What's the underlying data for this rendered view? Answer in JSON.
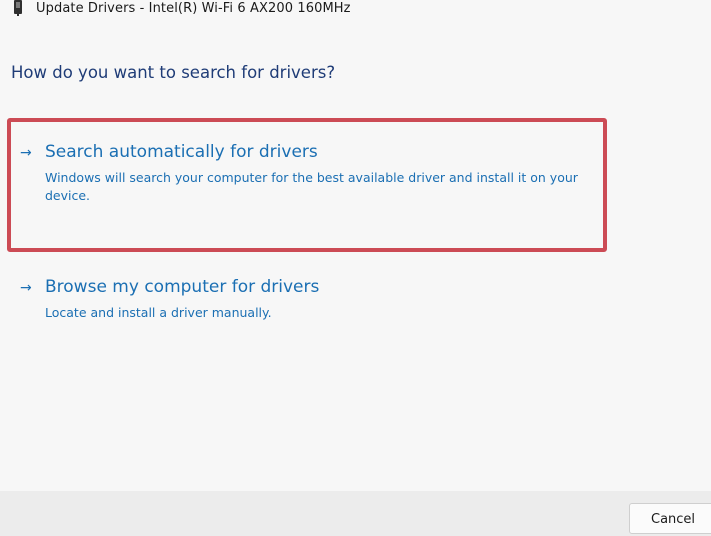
{
  "window": {
    "title": "Update Drivers - Intel(R) Wi-Fi 6 AX200 160MHz",
    "icon": "network-adapter-icon"
  },
  "question": "How do you want to search for drivers?",
  "options": [
    {
      "arrow": "→",
      "title": "Search automatically for drivers",
      "description": "Windows will search your computer for the best available driver and install it on your device.",
      "highlighted": true
    },
    {
      "arrow": "→",
      "title": "Browse my computer for drivers",
      "description": "Locate and install a driver manually.",
      "highlighted": false
    }
  ],
  "footer": {
    "cancel_label": "Cancel"
  },
  "colors": {
    "link": "#1b6fb3",
    "heading": "#1f3c77",
    "highlight_border": "#cc4b55",
    "background": "#f7f7f7",
    "footer_background": "#ececec"
  }
}
